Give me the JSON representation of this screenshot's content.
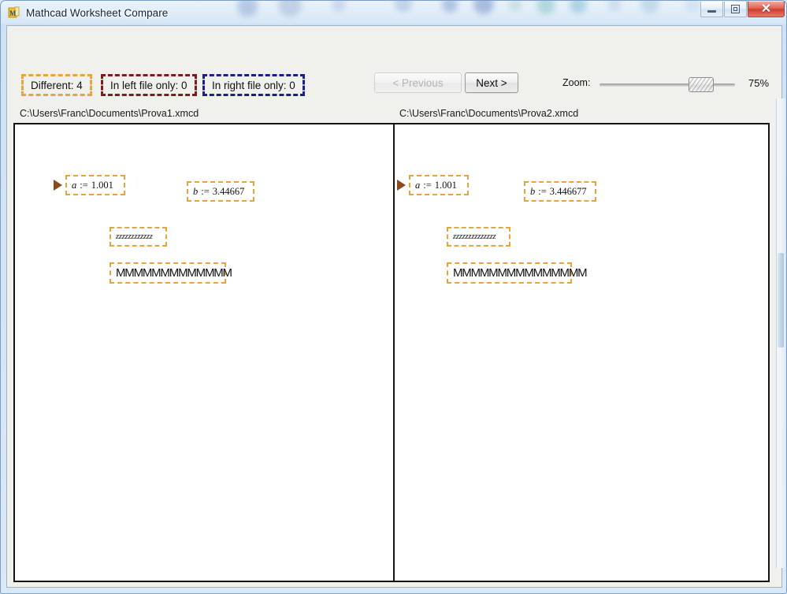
{
  "window": {
    "title": "Mathcad Worksheet Compare",
    "app_icon": "mathcad-icon",
    "controls": {
      "minimize": "minimize-icon",
      "restore": "restore-icon",
      "close": "✕"
    }
  },
  "toolbar": {
    "badges": [
      {
        "label": "Different: 4",
        "color": "#e8a33d",
        "name": "different-badge"
      },
      {
        "label": "In left file only: 0",
        "color": "#7d1d1d",
        "name": "left-only-badge"
      },
      {
        "label": "In right file only: 0",
        "color": "#1a1f8a",
        "name": "right-only-badge"
      }
    ],
    "previous_label": "< Previous",
    "previous_enabled": false,
    "next_label": "Next >",
    "next_enabled": true,
    "zoom_label": "Zoom:",
    "zoom_value": "75%",
    "zoom_percent": 75
  },
  "panes": {
    "left": {
      "path": "C:\\Users\\Franc\\Documents\\Prova1.xmcd",
      "regions": [
        {
          "name": "assignment-a",
          "var": "a",
          "op": ":=",
          "value": "1.001",
          "kind": "equation",
          "marked": true
        },
        {
          "name": "assignment-b",
          "var": "b",
          "op": ":=",
          "value": "3.44667",
          "kind": "equation",
          "marked": false
        },
        {
          "name": "text-z-block",
          "text": "zzzzzzzzzzzz",
          "kind": "text"
        },
        {
          "name": "text-m-block",
          "text": "MMMMMMMMMMMMM",
          "kind": "text"
        }
      ]
    },
    "right": {
      "path": "C:\\Users\\Franc\\Documents\\Prova2.xmcd",
      "regions": [
        {
          "name": "assignment-a",
          "var": "a",
          "op": ":=",
          "value": "1.001",
          "kind": "equation",
          "marked": true
        },
        {
          "name": "assignment-b",
          "op": ":=",
          "var": "b",
          "value": "3.446677",
          "kind": "equation",
          "marked": false
        },
        {
          "name": "text-z-block",
          "text": "zzzzzzzzzzzzzz",
          "kind": "text"
        },
        {
          "name": "text-m-block",
          "text": "MMMMMMMMMMMMMMM",
          "kind": "text"
        }
      ]
    }
  }
}
